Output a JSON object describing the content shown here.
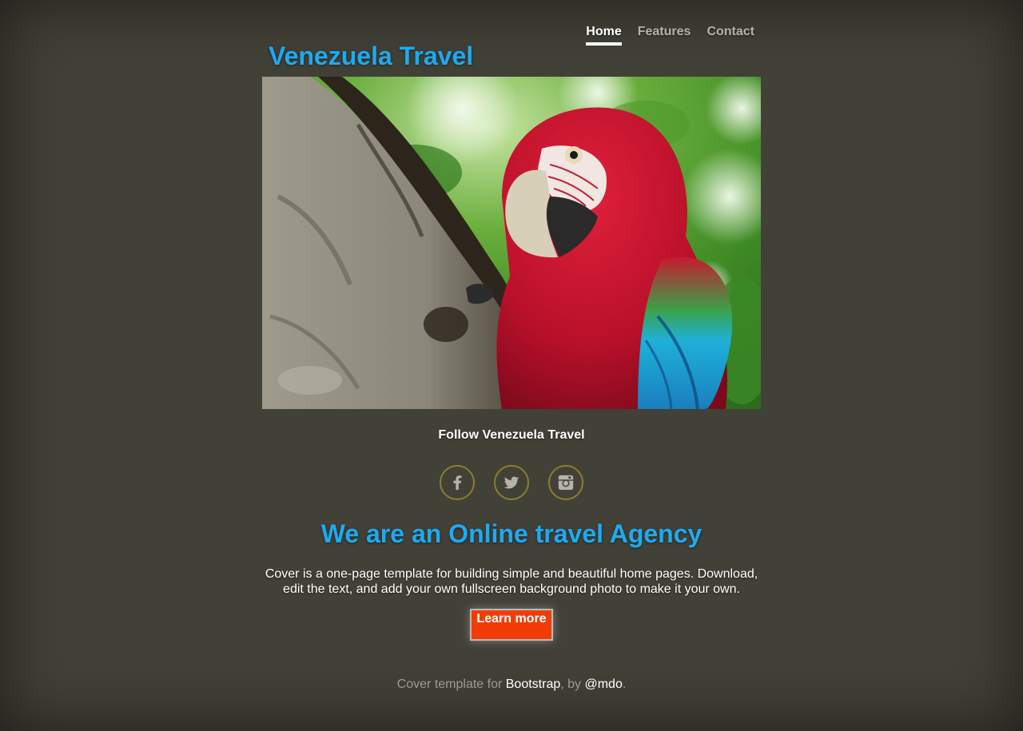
{
  "header": {
    "brand": "Venezuela Travel",
    "nav": [
      {
        "label": "Home",
        "active": true
      },
      {
        "label": "Features",
        "active": false
      },
      {
        "label": "Contact",
        "active": false
      }
    ]
  },
  "hero": {
    "image": "scarlet-macaw-on-tree-trunk"
  },
  "social": {
    "heading": "Follow Venezuela Travel",
    "icons": [
      "facebook-icon",
      "twitter-icon",
      "instagram-icon"
    ]
  },
  "main": {
    "headline": "We are an Online travel Agency",
    "lead_line1": "Cover is a one-page template for building simple and beautiful home pages. Download,",
    "lead_line2": "edit the text, and add your own fullscreen background photo to make it your own.",
    "button_label": "Learn more"
  },
  "footer": {
    "prefix": "Cover template for ",
    "link1": "Bootstrap",
    "middle": ", by ",
    "link2": "@mdo",
    "suffix": "."
  },
  "colors": {
    "background": "#424137",
    "accent": "#1eaaf1",
    "button": "#f23c07"
  }
}
